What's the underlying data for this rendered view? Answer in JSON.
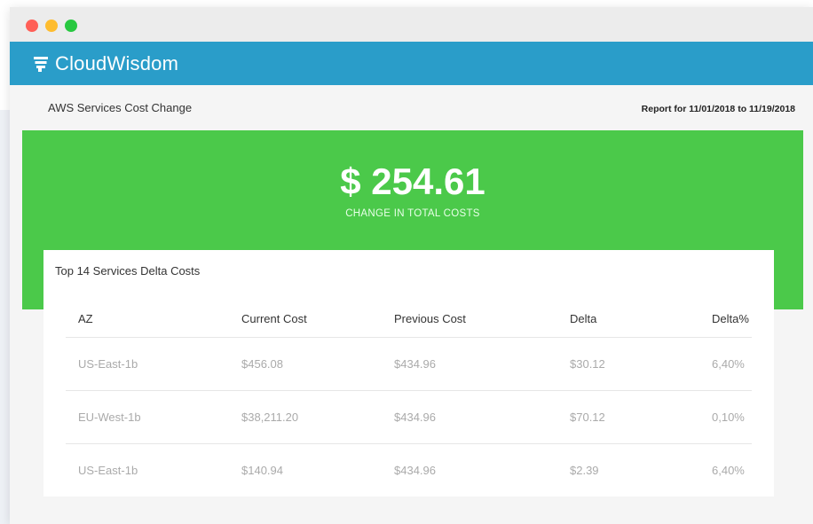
{
  "colors": {
    "titlebar_red": "#ff5f57",
    "titlebar_yellow": "#febc2e",
    "titlebar_green": "#28c840",
    "header_blue": "#2a9dc9",
    "banner_green": "#4bc94a"
  },
  "app": {
    "logo_text": "CloudWisdom",
    "logo_icon": "cloudwisdom-logo-icon"
  },
  "report": {
    "title": "AWS Services Cost Change",
    "range": "Report for 11/01/2018 to 11/19/2018"
  },
  "summary": {
    "amount": "$ 254.61",
    "label": "CHANGE IN TOTAL COSTS"
  },
  "services": {
    "title": "Top 14 Services Delta Costs",
    "columns": [
      "AZ",
      "Current Cost",
      "Previous Cost",
      "Delta",
      "Delta%"
    ],
    "rows": [
      [
        "US-East-1b",
        "$456.08",
        "$434.96",
        "$30.12",
        "6,40%"
      ],
      [
        "EU-West-1b",
        "$38,211.20",
        "$434.96",
        "$70.12",
        "0,10%"
      ],
      [
        "US-East-1b",
        "$140.94",
        "$434.96",
        "$2.39",
        "6,40%"
      ]
    ]
  }
}
